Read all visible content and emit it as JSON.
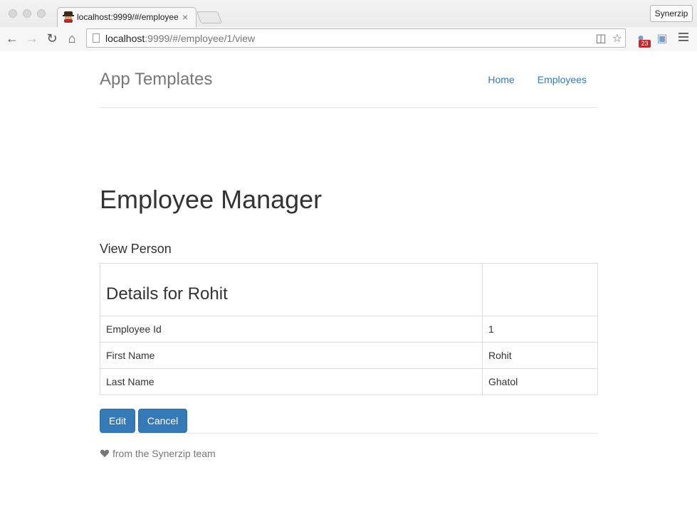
{
  "browser": {
    "tab_title": "localhost:9999/#/employee",
    "tab_close": "×",
    "profile": "Synerzip",
    "url_host": "localhost",
    "url_path": ":9999/#/employee/1/view",
    "ext_badge": "23"
  },
  "header": {
    "brand": "App Templates",
    "nav": [
      {
        "label": "Home"
      },
      {
        "label": "Employees"
      }
    ]
  },
  "main": {
    "title": "Employee Manager",
    "section_title": "View Person",
    "details_heading": "Details for Rohit",
    "rows": [
      {
        "label": "Employee Id",
        "value": "1"
      },
      {
        "label": "First Name",
        "value": "Rohit"
      },
      {
        "label": "Last Name",
        "value": "Ghatol"
      }
    ],
    "edit_label": "Edit",
    "cancel_label": "Cancel"
  },
  "footer": {
    "text": "from the Synerzip team"
  },
  "colors": {
    "link": "#337ab7",
    "primary_button": "#337ab7",
    "muted": "#777777"
  }
}
